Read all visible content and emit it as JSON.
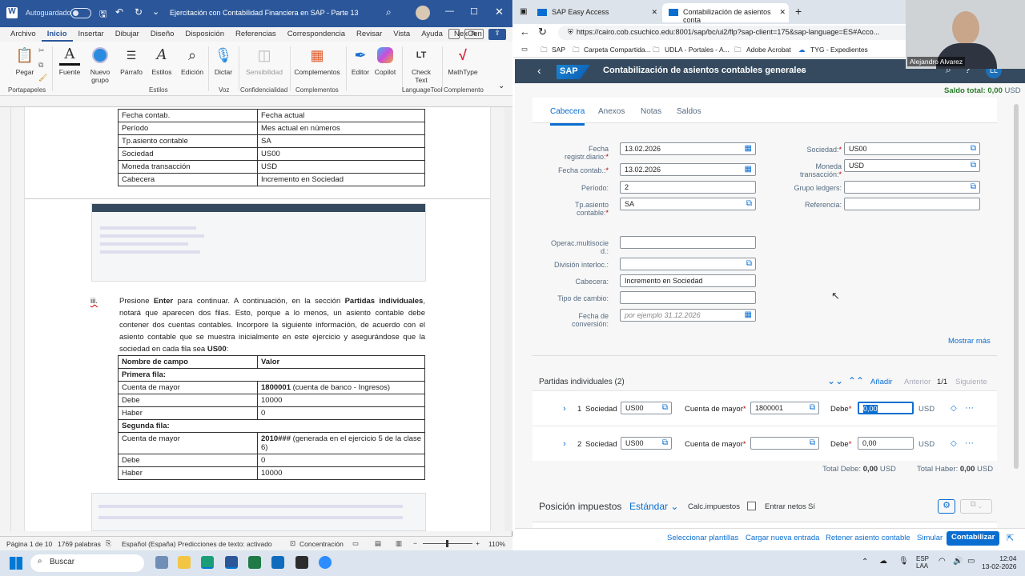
{
  "word": {
    "autosave_label": "Autoguardado",
    "doc_title": "Ejercitación con Contabilidad Financiera en SAP - Parte 13",
    "menu": [
      "Archivo",
      "Inicio",
      "Insertar",
      "Dibujar",
      "Diseño",
      "Disposición",
      "Referencias",
      "Correspondencia",
      "Revisar",
      "Vista",
      "Ayuda",
      "NexGen"
    ],
    "ribbon": {
      "pegar": "Pegar",
      "fuente": "Fuente",
      "nuevo_grupo": "Nuevo grupo",
      "parrafo": "Párrafo",
      "estilos": "Estilos",
      "edicion": "Edición",
      "dictar": "Dictar",
      "sensibilidad": "Sensibilidad",
      "complementos": "Complementos",
      "editor": "Editor",
      "copilot": "Copilot",
      "check_text": "Check Text",
      "mathtype": "MathType",
      "groups": [
        "Portapapeles",
        "Estilos",
        "Voz",
        "Confidencialidad",
        "Complementos",
        "LanguageTool",
        "Complemento"
      ]
    },
    "table1": [
      [
        "Fecha contab.",
        "Fecha actual"
      ],
      [
        "Período",
        "Mes actual en números"
      ],
      [
        "Tp.asiento contable",
        "SA"
      ],
      [
        "Sociedad",
        "US00"
      ],
      [
        "Moneda transacción",
        "USD"
      ],
      [
        "Cabecera",
        "Incremento en Sociedad"
      ]
    ],
    "step_marker": "iii.",
    "paragraph_pre": "Presione ",
    "paragraph_b1": "Enter",
    "paragraph_mid1": " para continuar. A continuación, en la sección ",
    "paragraph_b2": "Partidas individuales",
    "paragraph_mid2": ", notará que aparecen dos filas. Esto, porque a lo menos, un asiento contable debe contener dos cuentas contables. Incorpore la siguiente información, de acuerdo con el asiento contable que se muestra inicialmente en este ejercicio y asegurándose que la sociedad en cada fila sea ",
    "paragraph_b3": "US00",
    "paragraph_end": ":",
    "table2": {
      "h1": "Nombre de campo",
      "h2": "Valor",
      "first_row": "Primera fila:",
      "r1a": "Cuenta de mayor",
      "r1b_bold": "1800001",
      "r1b_rest": " (cuenta de banco - Ingresos)",
      "r2a": "Debe",
      "r2b": "10000",
      "r3a": "Haber",
      "r3b": "0",
      "second_row": "Segunda fila:",
      "r4a": "Cuenta de mayor",
      "r4b_bold": "2010###",
      "r4b_rest": " (generada en el ejercicio 5 de la clase 6)",
      "r5a": "Debe",
      "r5b": "0",
      "r6a": "Haber",
      "r6b": "10000"
    },
    "status": {
      "page": "Página 1 de 10",
      "words": "1769 palabras",
      "lang": "Español (España)",
      "predict": "Predicciones de texto: activado",
      "focus": "Concentración",
      "zoom": "110%"
    }
  },
  "browser": {
    "tab1": "SAP Easy Access",
    "tab2": "Contabilización de asientos conta",
    "url": "https://cairo.cob.csuchico.edu:8001/sap/bc/ui2/flp?sap-client=175&sap-language=ES#Acco...",
    "bookmarks": [
      "SAP",
      "Carpeta Compartida...",
      "UDLA - Portales - A...",
      "Adobe Acrobat",
      "TYG - Expedientes"
    ]
  },
  "sap": {
    "title": "Contabilización de asientos contables generales",
    "saldo_label": "Saldo total:",
    "saldo_value": "0,00",
    "saldo_currency": "USD",
    "tabs": [
      "Cabecera",
      "Anexos",
      "Notas",
      "Saldos"
    ],
    "fields": {
      "fecha_registro_label1": "Fecha",
      "fecha_registro_label2": "registr.diario:",
      "fecha_registro": "13.02.2026",
      "fecha_contab_label": "Fecha contab.:",
      "fecha_contab": "13.02.2026",
      "periodo_label": "Período:",
      "periodo": "2",
      "tp_label1": "Tp.asiento",
      "tp_label2": "contable:",
      "tp": "SA",
      "sociedad_label": "Sociedad:",
      "sociedad": "US00",
      "moneda_label1": "Moneda",
      "moneda_label2": "transacción:",
      "moneda": "USD",
      "grupo_label": "Grupo ledgers:",
      "referencia_label": "Referencia:",
      "operac_label1": "Operac.multisocie",
      "operac_label2": "d.:",
      "division_label": "División interloc.:",
      "cabecera_label": "Cabecera:",
      "cabecera": "Incremento en Sociedad",
      "tipo_cambio_label": "Tipo de cambio:",
      "fecha_conv_label1": "Fecha de",
      "fecha_conv_label2": "conversión:",
      "fecha_conv_placeholder": "por ejemplo 31.12.2026"
    },
    "mostrar_mas": "Mostrar más",
    "partidas": {
      "title": "Partidas individuales (2)",
      "anadir": "Añadir",
      "anterior": "Anterior",
      "pager": "1/1",
      "siguiente": "Siguiente",
      "rows": [
        {
          "num": "1",
          "sociedad_label": "Sociedad",
          "sociedad": "US00",
          "cuenta_label": "Cuenta de mayor",
          "cuenta": "1800001",
          "debe_label": "Debe",
          "debe": "0,00",
          "currency": "USD"
        },
        {
          "num": "2",
          "sociedad_label": "Sociedad",
          "sociedad": "US00",
          "cuenta_label": "Cuenta de mayor",
          "cuenta": "",
          "debe_label": "Debe",
          "debe": "0,00",
          "currency": "USD"
        }
      ],
      "total_debe_label": "Total Debe:",
      "total_debe": "0,00",
      "total_haber_label": "Total Haber:",
      "total_haber": "0,00",
      "total_currency": "USD"
    },
    "impuestos": {
      "title": "Posición impuestos",
      "variant": "Estándar",
      "calc_label": "Calc.impuestos",
      "entrar_label": "Entrar netos",
      "entrar_value": "Sí"
    },
    "footer": {
      "plantillas": "Seleccionar plantillas",
      "cargar": "Cargar nueva entrada",
      "retener": "Retener asiento contable",
      "simular": "Simular",
      "contabilizar": "Contabilizar"
    },
    "avatar": "LL"
  },
  "webcam": {
    "name": "Alejandro Alvarez"
  },
  "taskbar": {
    "search": "Buscar",
    "lang1": "ESP",
    "lang2": "LAA",
    "time": "12:04",
    "date": "13-02-2026"
  },
  "colors": {
    "word_blue": "#2b579a",
    "sap_shell": "#354a5f",
    "sap_blue": "#0a6ed1"
  }
}
